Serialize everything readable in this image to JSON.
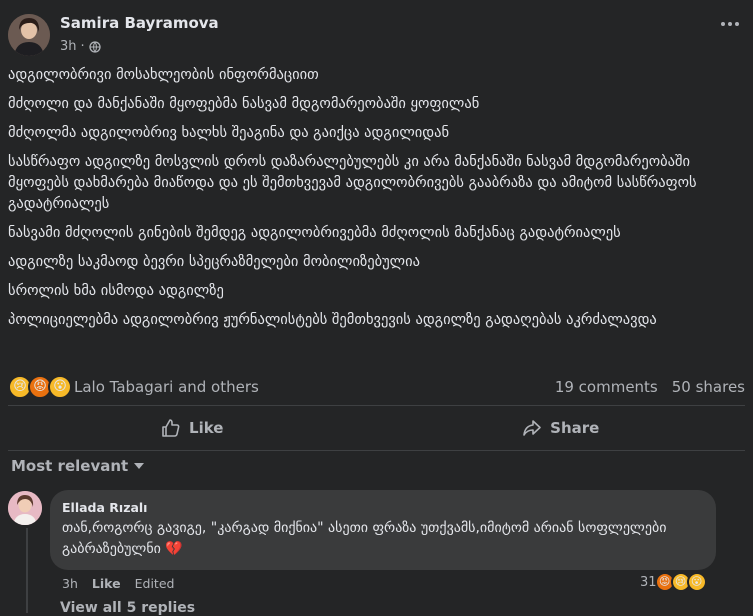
{
  "post": {
    "author": "Samira Bayramova",
    "time": "3h",
    "paragraphs": [
      "ადგილობრივი მოსახლეობის ინფორმაციით",
      "მძღოლი და მანქანაში მყოფებმა ნასვამ მდგომარეობაში ყოფილან",
      "მძღოლმა ადგილობრივ ხალხს შეაგინა და გაიქცა ადგილიდან",
      "სასწრაფო ადგილზე მოსვლის დროს დაზარალებულებს კი არა მანქანაში ნასვამ მდგომარეობაში მყოფებს დახმარება მიაწოდა და ეს შემთხვევამ ადგილობრივებს გააბრაზა და ამიტომ სასწრაფოს გადატრიალეს",
      "ნასვამი მძღოლის გინების შემდეგ ადგილობრივებმა მძღოლის მანქანაც გადატრიალეს",
      "ადგილზე საკმაოდ ბევრი სპეცრაზმელები მობილიზებულია",
      "სროლის ხმა ისმოდა ადგილზე",
      "პოლიციელებმა ადგილობრივ ჟურნალისტებს შემთხვევის ადგილზე გადაღებას აკრძალავდა"
    ]
  },
  "reactions": {
    "icons": [
      "sad-emoji",
      "angry-emoji",
      "wow-emoji"
    ],
    "names": "Lalo Tabagari and others",
    "comments": "19 comments",
    "shares": "50 shares"
  },
  "actions": {
    "like": "Like",
    "share": "Share"
  },
  "sort_label": "Most relevant",
  "comment": {
    "author": "Ellada Rızalı",
    "text": "თან,როგორც გავიგე, \"კარგად მიქნია\" ასეთი ფრაზა უთქვამს,იმიტომ არიან სოფლელები გაბრაზებულნი",
    "time": "3h",
    "like": "Like",
    "edited": "Edited",
    "reaction_count": "31",
    "reply_link": "View all 5 replies"
  },
  "colors": {
    "background": "#242526",
    "bubble": "#3a3b3c",
    "text": "#e4e6eb",
    "muted": "#b0b3b8"
  }
}
